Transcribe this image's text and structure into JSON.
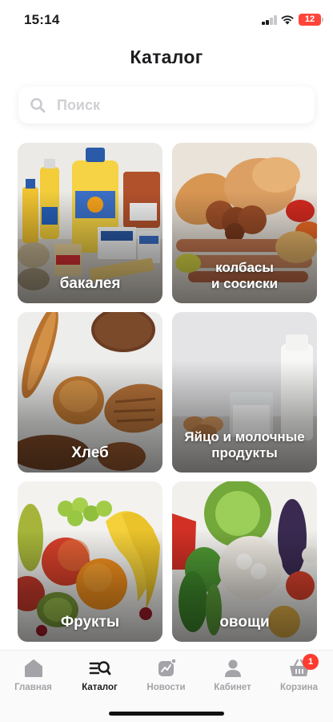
{
  "status_bar": {
    "time": "15:14",
    "battery": "12"
  },
  "header": {
    "title": "Каталог"
  },
  "search": {
    "placeholder": "Поиск"
  },
  "categories": [
    {
      "label": "бакалея"
    },
    {
      "label": "колбасы\nи сосиски"
    },
    {
      "label": "Хлеб"
    },
    {
      "label": "Яйцо и молочные продукты"
    },
    {
      "label": "Фрукты"
    },
    {
      "label": "овощи"
    }
  ],
  "tab_bar": {
    "items": [
      {
        "label": "Главная",
        "icon": "home-icon"
      },
      {
        "label": "Каталог",
        "icon": "catalog-icon"
      },
      {
        "label": "Новости",
        "icon": "news-icon"
      },
      {
        "label": "Кабинет",
        "icon": "profile-icon"
      },
      {
        "label": "Корзина",
        "icon": "basket-icon"
      }
    ],
    "active": "Каталог",
    "cart_count": "1"
  },
  "colors": {
    "accent": "#ff3b30",
    "inactive": "#a3a3a8",
    "active": "#1c1c1e"
  }
}
